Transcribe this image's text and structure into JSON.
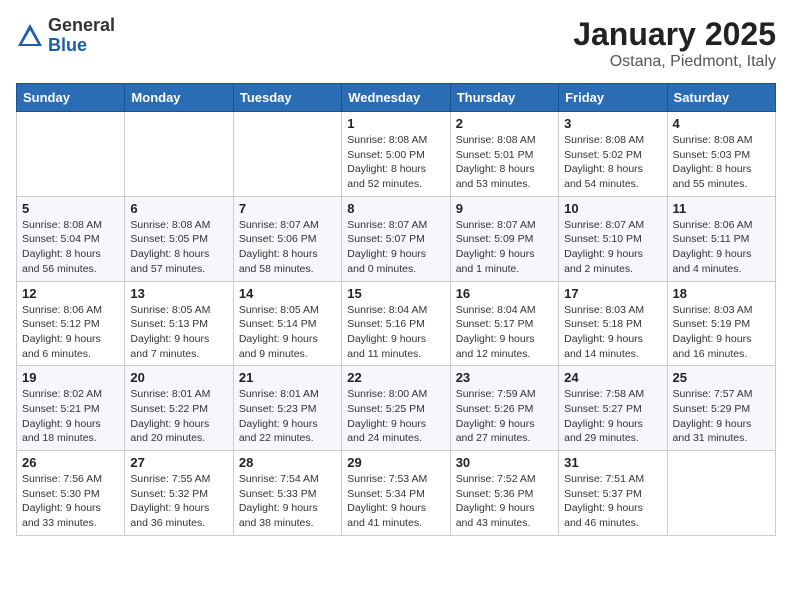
{
  "header": {
    "logo_general": "General",
    "logo_blue": "Blue",
    "month": "January 2025",
    "location": "Ostana, Piedmont, Italy"
  },
  "weekdays": [
    "Sunday",
    "Monday",
    "Tuesday",
    "Wednesday",
    "Thursday",
    "Friday",
    "Saturday"
  ],
  "weeks": [
    [
      {
        "day": "",
        "info": ""
      },
      {
        "day": "",
        "info": ""
      },
      {
        "day": "",
        "info": ""
      },
      {
        "day": "1",
        "info": "Sunrise: 8:08 AM\nSunset: 5:00 PM\nDaylight: 8 hours\nand 52 minutes."
      },
      {
        "day": "2",
        "info": "Sunrise: 8:08 AM\nSunset: 5:01 PM\nDaylight: 8 hours\nand 53 minutes."
      },
      {
        "day": "3",
        "info": "Sunrise: 8:08 AM\nSunset: 5:02 PM\nDaylight: 8 hours\nand 54 minutes."
      },
      {
        "day": "4",
        "info": "Sunrise: 8:08 AM\nSunset: 5:03 PM\nDaylight: 8 hours\nand 55 minutes."
      }
    ],
    [
      {
        "day": "5",
        "info": "Sunrise: 8:08 AM\nSunset: 5:04 PM\nDaylight: 8 hours\nand 56 minutes."
      },
      {
        "day": "6",
        "info": "Sunrise: 8:08 AM\nSunset: 5:05 PM\nDaylight: 8 hours\nand 57 minutes."
      },
      {
        "day": "7",
        "info": "Sunrise: 8:07 AM\nSunset: 5:06 PM\nDaylight: 8 hours\nand 58 minutes."
      },
      {
        "day": "8",
        "info": "Sunrise: 8:07 AM\nSunset: 5:07 PM\nDaylight: 9 hours\nand 0 minutes."
      },
      {
        "day": "9",
        "info": "Sunrise: 8:07 AM\nSunset: 5:09 PM\nDaylight: 9 hours\nand 1 minute."
      },
      {
        "day": "10",
        "info": "Sunrise: 8:07 AM\nSunset: 5:10 PM\nDaylight: 9 hours\nand 2 minutes."
      },
      {
        "day": "11",
        "info": "Sunrise: 8:06 AM\nSunset: 5:11 PM\nDaylight: 9 hours\nand 4 minutes."
      }
    ],
    [
      {
        "day": "12",
        "info": "Sunrise: 8:06 AM\nSunset: 5:12 PM\nDaylight: 9 hours\nand 6 minutes."
      },
      {
        "day": "13",
        "info": "Sunrise: 8:05 AM\nSunset: 5:13 PM\nDaylight: 9 hours\nand 7 minutes."
      },
      {
        "day": "14",
        "info": "Sunrise: 8:05 AM\nSunset: 5:14 PM\nDaylight: 9 hours\nand 9 minutes."
      },
      {
        "day": "15",
        "info": "Sunrise: 8:04 AM\nSunset: 5:16 PM\nDaylight: 9 hours\nand 11 minutes."
      },
      {
        "day": "16",
        "info": "Sunrise: 8:04 AM\nSunset: 5:17 PM\nDaylight: 9 hours\nand 12 minutes."
      },
      {
        "day": "17",
        "info": "Sunrise: 8:03 AM\nSunset: 5:18 PM\nDaylight: 9 hours\nand 14 minutes."
      },
      {
        "day": "18",
        "info": "Sunrise: 8:03 AM\nSunset: 5:19 PM\nDaylight: 9 hours\nand 16 minutes."
      }
    ],
    [
      {
        "day": "19",
        "info": "Sunrise: 8:02 AM\nSunset: 5:21 PM\nDaylight: 9 hours\nand 18 minutes."
      },
      {
        "day": "20",
        "info": "Sunrise: 8:01 AM\nSunset: 5:22 PM\nDaylight: 9 hours\nand 20 minutes."
      },
      {
        "day": "21",
        "info": "Sunrise: 8:01 AM\nSunset: 5:23 PM\nDaylight: 9 hours\nand 22 minutes."
      },
      {
        "day": "22",
        "info": "Sunrise: 8:00 AM\nSunset: 5:25 PM\nDaylight: 9 hours\nand 24 minutes."
      },
      {
        "day": "23",
        "info": "Sunrise: 7:59 AM\nSunset: 5:26 PM\nDaylight: 9 hours\nand 27 minutes."
      },
      {
        "day": "24",
        "info": "Sunrise: 7:58 AM\nSunset: 5:27 PM\nDaylight: 9 hours\nand 29 minutes."
      },
      {
        "day": "25",
        "info": "Sunrise: 7:57 AM\nSunset: 5:29 PM\nDaylight: 9 hours\nand 31 minutes."
      }
    ],
    [
      {
        "day": "26",
        "info": "Sunrise: 7:56 AM\nSunset: 5:30 PM\nDaylight: 9 hours\nand 33 minutes."
      },
      {
        "day": "27",
        "info": "Sunrise: 7:55 AM\nSunset: 5:32 PM\nDaylight: 9 hours\nand 36 minutes."
      },
      {
        "day": "28",
        "info": "Sunrise: 7:54 AM\nSunset: 5:33 PM\nDaylight: 9 hours\nand 38 minutes."
      },
      {
        "day": "29",
        "info": "Sunrise: 7:53 AM\nSunset: 5:34 PM\nDaylight: 9 hours\nand 41 minutes."
      },
      {
        "day": "30",
        "info": "Sunrise: 7:52 AM\nSunset: 5:36 PM\nDaylight: 9 hours\nand 43 minutes."
      },
      {
        "day": "31",
        "info": "Sunrise: 7:51 AM\nSunset: 5:37 PM\nDaylight: 9 hours\nand 46 minutes."
      },
      {
        "day": "",
        "info": ""
      }
    ]
  ]
}
